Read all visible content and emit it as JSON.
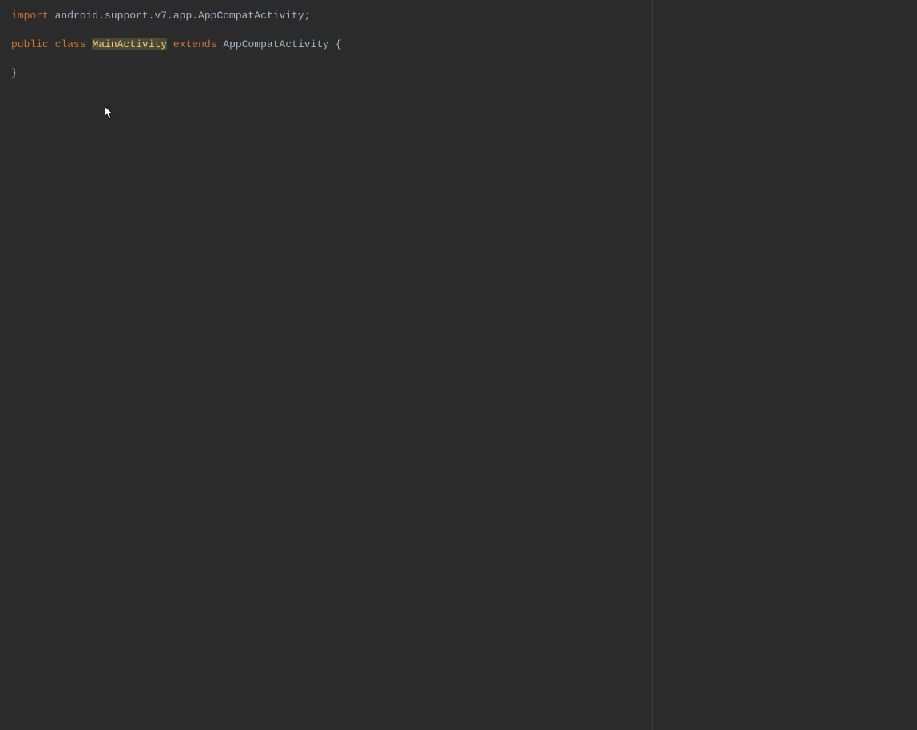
{
  "code": {
    "line1": {
      "kw_import": "import",
      "sp1": " ",
      "pkg": "android.support.v7.app.AppCompatActivity",
      "semi": ";"
    },
    "line2": "",
    "line3": {
      "kw_public": "public",
      "sp1": " ",
      "kw_class": "class",
      "sp2": " ",
      "class_name": "MainActivity",
      "sp3": " ",
      "kw_extends": "extends",
      "sp4": " ",
      "super_type": "AppCompatActivity",
      "sp5": " ",
      "open_brace": "{"
    },
    "line4": "",
    "line5": {
      "close_brace": "}"
    }
  }
}
